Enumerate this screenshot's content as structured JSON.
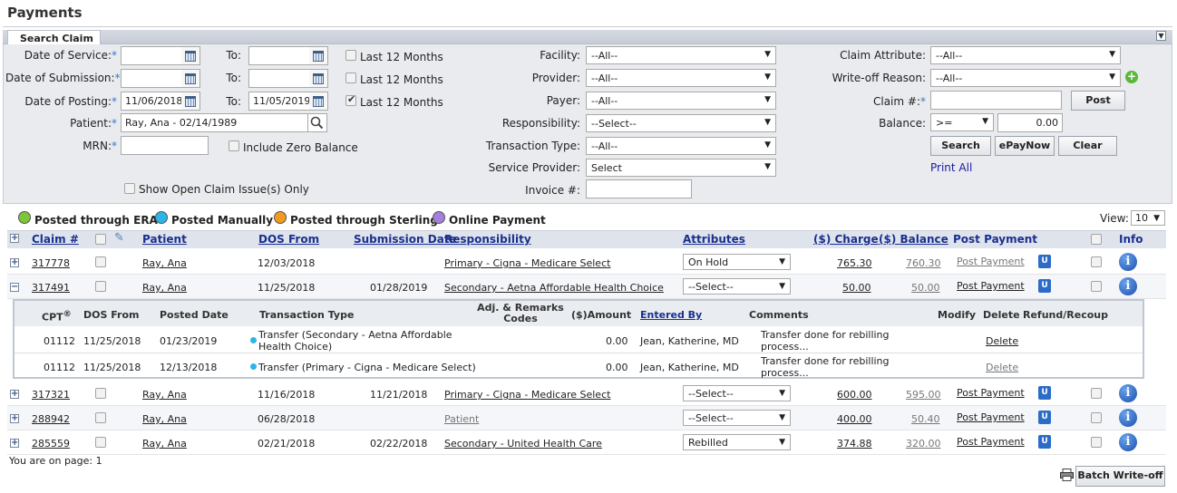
{
  "page_title": "Payments",
  "search_tab": "Search Claim",
  "filters": {
    "dos_label": "Date of Service:",
    "dos_from": "",
    "dos_to": "",
    "dos_last12": "Last 12 Months",
    "sub_label": "Date of Submission:",
    "sub_from": "",
    "sub_to": "",
    "sub_last12": "Last 12 Months",
    "post_label": "Date of Posting:",
    "post_from": "11/06/2018",
    "post_to": "11/05/2019",
    "post_last12": "Last 12 Months",
    "to_label": "To:",
    "patient_label": "Patient:",
    "patient_value": "Ray, Ana - 02/14/1989",
    "mrn_label": "MRN:",
    "mrn_value": "",
    "zero_balance": "Include Zero Balance",
    "open_issues": "Show Open Claim Issue(s) Only",
    "facility_label": "Facility:",
    "facility_value": "--All--",
    "provider_label": "Provider:",
    "provider_value": "--All--",
    "payer_label": "Payer:",
    "payer_value": "--All--",
    "responsibility_label": "Responsibility:",
    "responsibility_value": "--Select--",
    "transaction_label": "Transaction Type:",
    "transaction_value": "--All--",
    "service_provider_label": "Service Provider:",
    "service_provider_value": "Select",
    "invoice_label": "Invoice #:",
    "invoice_value": "",
    "claim_attr_label": "Claim Attribute:",
    "claim_attr_value": "--All--",
    "writeoff_label": "Write-off Reason:",
    "writeoff_value": "--All--",
    "claim_no_label": "Claim #:",
    "claim_no_value": "",
    "post_button": "Post",
    "balance_label": "Balance:",
    "balance_op": ">=",
    "balance_value": "0.00",
    "search_button": "Search",
    "epay_button": "ePayNow",
    "clear_button": "Clear",
    "print_all": "Print All",
    "req_mark": "*"
  },
  "legend": {
    "era": "Posted through ERA",
    "manual": "Posted Manually",
    "sterling": "Posted through Sterling",
    "online": "Online Payment",
    "view_label": "View:",
    "view_value": "10",
    "colors": {
      "era": "#7cc63a",
      "manual": "#2bb5e8",
      "sterling": "#f29a1f",
      "online": "#a57ee0"
    }
  },
  "columns": {
    "claim": "Claim #",
    "patient": "Patient",
    "dos_from": "DOS From",
    "submission": "Submission Date",
    "responsibility": "Responsibility",
    "attributes": "Attributes",
    "charge": "($) Charge",
    "balance": "($) Balance",
    "post_payment": "Post Payment",
    "info": "Info"
  },
  "rows": [
    {
      "claim": "317778",
      "patient": "Ray, Ana",
      "dos": "12/03/2018",
      "submission": "",
      "responsibility": "Primary - Cigna - Medicare Select",
      "attribute": "On Hold",
      "charge": "765.30",
      "balance": "760.30",
      "post": "Post Payment",
      "u": "U"
    },
    {
      "claim": "317491",
      "patient": "Ray, Ana",
      "dos": "11/25/2018",
      "submission": "01/28/2019",
      "responsibility": "Secondary - Aetna Affordable Health Choice",
      "attribute": "--Select--",
      "charge": "50.00",
      "balance": "50.00",
      "post": "Post Payment",
      "u": "U"
    },
    {
      "claim": "317321",
      "patient": "Ray, Ana",
      "dos": "11/16/2018",
      "submission": "11/21/2018",
      "responsibility": "Primary - Cigna - Medicare Select",
      "attribute": "--Select--",
      "charge": "600.00",
      "balance": "595.00",
      "post": "Post Payment",
      "u": "U"
    },
    {
      "claim": "288942",
      "patient": "Ray, Ana",
      "dos": "06/28/2018",
      "submission": "",
      "responsibility": "Patient",
      "attribute": "--Select--",
      "charge": "400.00",
      "balance": "50.40",
      "post": "Post Payment",
      "u": "U"
    },
    {
      "claim": "285559",
      "patient": "Ray, Ana",
      "dos": "02/21/2018",
      "submission": "02/22/2018",
      "responsibility": "Secondary - United Health Care",
      "attribute": "Rebilled",
      "charge": "374.88",
      "balance": "320.00",
      "post": "Post Payment",
      "u": "U"
    }
  ],
  "detail": {
    "headers": {
      "cpt": "CPT",
      "dos": "DOS From",
      "posted": "Posted Date",
      "type": "Transaction Type",
      "adj": "Adj. & Remarks Codes",
      "amount": "($)Amount",
      "entered": "Entered By",
      "comments": "Comments",
      "modify": "Modify",
      "delete": "Delete",
      "refund": "Refund/Recoup"
    },
    "rows": [
      {
        "cpt": "01112",
        "dos": "11/25/2018",
        "posted": "01/23/2019",
        "type": "Transfer (Secondary - Aetna Affordable Health Choice)",
        "amount": "0.00",
        "entered": "Jean, Katherine, MD",
        "comments": "Transfer done for rebilling process...",
        "delete": "Delete"
      },
      {
        "cpt": "01112",
        "dos": "11/25/2018",
        "posted": "12/13/2018",
        "type": "Transfer (Primary - Cigna - Medicare Select)",
        "amount": "0.00",
        "entered": "Jean, Katherine, MD",
        "comments": "Transfer done for rebilling process...",
        "delete": "Delete"
      }
    ]
  },
  "footer": {
    "page_text": "You are on page: 1",
    "batch_button": "Batch Write-off"
  }
}
